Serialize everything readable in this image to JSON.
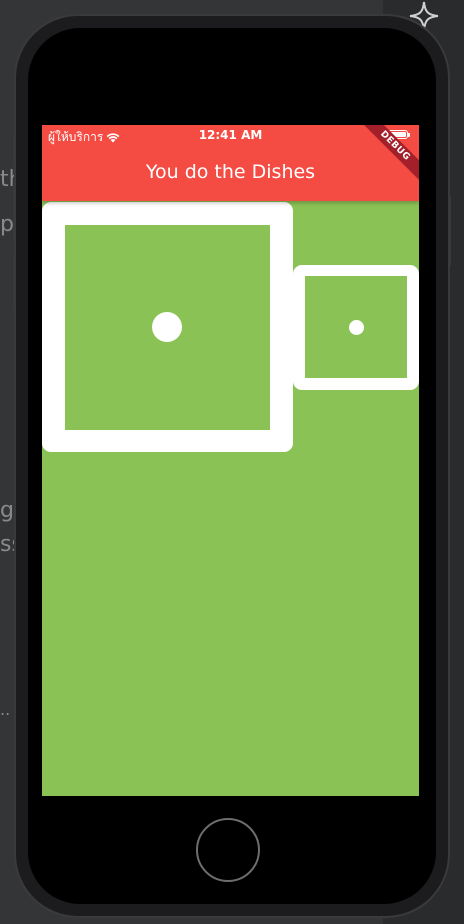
{
  "status_bar": {
    "carrier": "ผู้ให้บริการ",
    "time": "12:41 AM",
    "wifi_icon": "wifi-icon",
    "battery_icon": "battery-icon"
  },
  "app_bar": {
    "title": "You do the Dishes"
  },
  "debug_banner": {
    "label": "DEBUG"
  },
  "dice": [
    {
      "name": "left-dice",
      "pips": 1
    },
    {
      "name": "right-dice",
      "pips": 1
    }
  ],
  "colors": {
    "app_bar": "#f44b43",
    "background": "#8bc256",
    "dice": "#ffffff",
    "debug_banner": "#a3202b"
  },
  "background_editor": {
    "fragments": [
      "th",
      "p",
      "ge",
      "ss",
      ".."
    ]
  }
}
